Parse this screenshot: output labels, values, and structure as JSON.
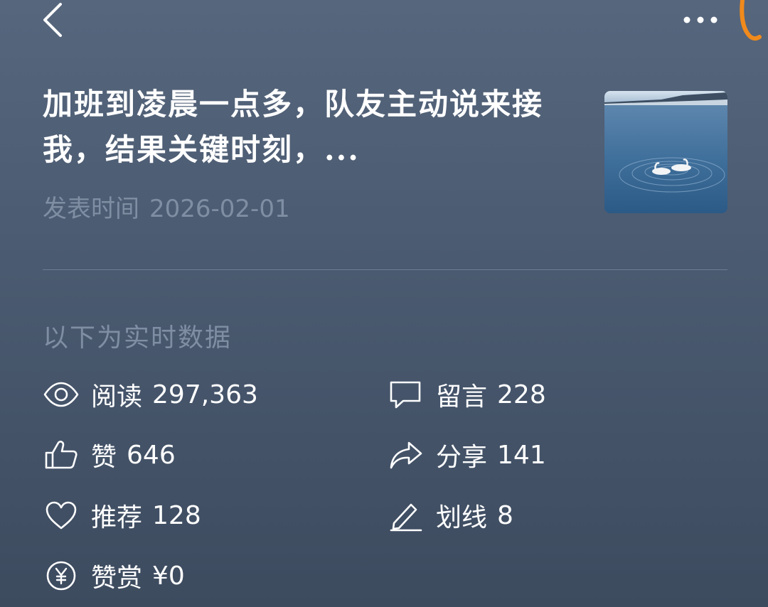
{
  "article": {
    "title": "加班到凌晨一点多，队友主动说来接我，结果关键时刻，...",
    "published_label": "发表时间",
    "published_date": "2026-02-01"
  },
  "stats_header": "以下为实时数据",
  "stats": {
    "read": {
      "label": "阅读",
      "value": "297,363",
      "icon": "eye-icon"
    },
    "comment": {
      "label": "留言",
      "value": "228",
      "icon": "comment-icon"
    },
    "like": {
      "label": "赞",
      "value": "646",
      "icon": "thumbs-up-icon"
    },
    "share": {
      "label": "分享",
      "value": "141",
      "icon": "share-icon"
    },
    "recommend": {
      "label": "推荐",
      "value": "128",
      "icon": "heart-icon"
    },
    "highlight": {
      "label": "划线",
      "value": "8",
      "icon": "pen-icon"
    },
    "reward": {
      "label": "赞赏",
      "value": "¥0",
      "icon": "yen-coin-icon"
    }
  },
  "colors": {
    "background": "#4b5b71",
    "muted_text": "#7f8ea3",
    "accent_mark": "#f08a1c"
  }
}
